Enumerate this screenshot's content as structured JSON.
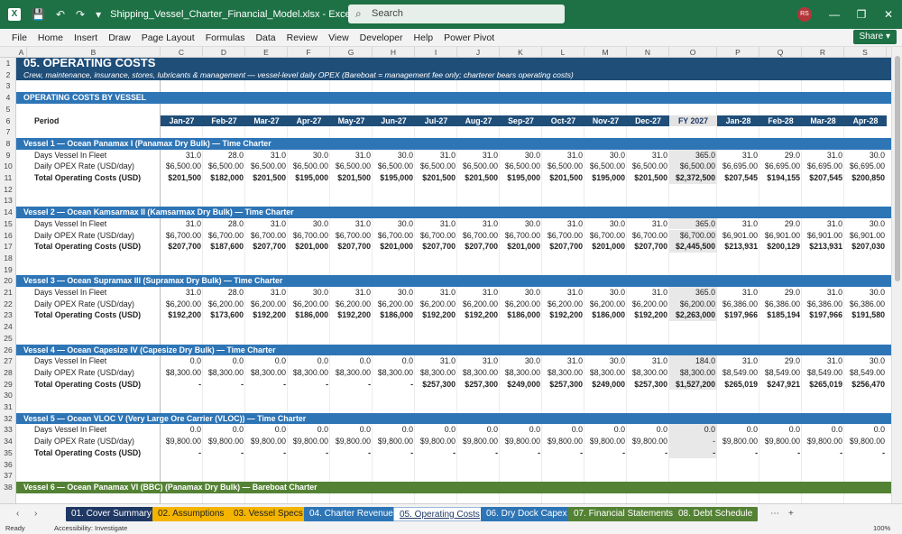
{
  "window": {
    "title": "Shipping_Vessel_Charter_Financial_Model.xlsx - Excel",
    "search_placeholder": "Search",
    "avatar": "RS",
    "app_icon": "X"
  },
  "menu": [
    "File",
    "Home",
    "Insert",
    "Draw",
    "Page Layout",
    "Formulas",
    "Data",
    "Review",
    "View",
    "Developer",
    "Help",
    "Power Pivot"
  ],
  "share_label": "Share",
  "columns": [
    "A",
    "B",
    "C",
    "D",
    "E",
    "F",
    "G",
    "H",
    "I",
    "J",
    "K",
    "L",
    "M",
    "N",
    "O",
    "P",
    "Q",
    "R",
    "S"
  ],
  "row_numbers": [
    "1",
    "2",
    "3",
    "4",
    "5",
    "6",
    "7",
    "8",
    "9",
    "10",
    "11",
    "12",
    "13",
    "14",
    "15",
    "16",
    "17",
    "18",
    "19",
    "20",
    "21",
    "22",
    "23",
    "24",
    "25",
    "26",
    "27",
    "28",
    "29",
    "30",
    "31",
    "32",
    "33",
    "34",
    "35",
    "36",
    "37",
    "38"
  ],
  "sheet": {
    "title": "05.  OPERATING COSTS",
    "subtitle": "Crew, maintenance, insurance, stores, lubricants & management — vessel-level daily OPEX (Bareboat = management fee only; charterer bears operating costs)",
    "section": "OPERATING COSTS BY VESSEL",
    "period_label": "Period",
    "periods": [
      "Jan-27",
      "Feb-27",
      "Mar-27",
      "Apr-27",
      "May-27",
      "Jun-27",
      "Jul-27",
      "Aug-27",
      "Sep-27",
      "Oct-27",
      "Nov-27",
      "Dec-27",
      "FY 2027",
      "Jan-28",
      "Feb-28",
      "Mar-28",
      "Apr-28"
    ],
    "vessels": [
      {
        "title": "Vessel 1  —  Ocean Panamax I  (Panamax Dry Bulk)  —  Time Charter",
        "band_color": "#2e75b6",
        "rows": [
          {
            "label": "Days Vessel In Fleet",
            "bold": false,
            "values": [
              "31.0",
              "28.0",
              "31.0",
              "30.0",
              "31.0",
              "30.0",
              "31.0",
              "31.0",
              "30.0",
              "31.0",
              "30.0",
              "31.0",
              "365.0",
              "31.0",
              "29.0",
              "31.0",
              "30.0"
            ]
          },
          {
            "label": "Daily OPEX Rate (USD/day)",
            "bold": false,
            "values": [
              "$6,500.00",
              "$6,500.00",
              "$6,500.00",
              "$6,500.00",
              "$6,500.00",
              "$6,500.00",
              "$6,500.00",
              "$6,500.00",
              "$6,500.00",
              "$6,500.00",
              "$6,500.00",
              "$6,500.00",
              "$6,500.00",
              "$6,695.00",
              "$6,695.00",
              "$6,695.00",
              "$6,695.00"
            ]
          },
          {
            "label": "Total Operating Costs (USD)",
            "bold": true,
            "values": [
              "$201,500",
              "$182,000",
              "$201,500",
              "$195,000",
              "$201,500",
              "$195,000",
              "$201,500",
              "$201,500",
              "$195,000",
              "$201,500",
              "$195,000",
              "$201,500",
              "$2,372,500",
              "$207,545",
              "$194,155",
              "$207,545",
              "$200,850"
            ]
          }
        ]
      },
      {
        "title": "Vessel 2  —  Ocean Kamsarmax II  (Kamsarmax Dry Bulk)  —  Time Charter",
        "band_color": "#2e75b6",
        "rows": [
          {
            "label": "Days Vessel In Fleet",
            "bold": false,
            "values": [
              "31.0",
              "28.0",
              "31.0",
              "30.0",
              "31.0",
              "30.0",
              "31.0",
              "31.0",
              "30.0",
              "31.0",
              "30.0",
              "31.0",
              "365.0",
              "31.0",
              "29.0",
              "31.0",
              "30.0"
            ]
          },
          {
            "label": "Daily OPEX Rate (USD/day)",
            "bold": false,
            "values": [
              "$6,700.00",
              "$6,700.00",
              "$6,700.00",
              "$6,700.00",
              "$6,700.00",
              "$6,700.00",
              "$6,700.00",
              "$6,700.00",
              "$6,700.00",
              "$6,700.00",
              "$6,700.00",
              "$6,700.00",
              "$6,700.00",
              "$6,901.00",
              "$6,901.00",
              "$6,901.00",
              "$6,901.00"
            ]
          },
          {
            "label": "Total Operating Costs (USD)",
            "bold": true,
            "values": [
              "$207,700",
              "$187,600",
              "$207,700",
              "$201,000",
              "$207,700",
              "$201,000",
              "$207,700",
              "$207,700",
              "$201,000",
              "$207,700",
              "$201,000",
              "$207,700",
              "$2,445,500",
              "$213,931",
              "$200,129",
              "$213,931",
              "$207,030"
            ]
          }
        ]
      },
      {
        "title": "Vessel 3  —  Ocean Supramax III  (Supramax Dry Bulk)  —  Time Charter",
        "band_color": "#2e75b6",
        "rows": [
          {
            "label": "Days Vessel In Fleet",
            "bold": false,
            "values": [
              "31.0",
              "28.0",
              "31.0",
              "30.0",
              "31.0",
              "30.0",
              "31.0",
              "31.0",
              "30.0",
              "31.0",
              "30.0",
              "31.0",
              "365.0",
              "31.0",
              "29.0",
              "31.0",
              "30.0"
            ]
          },
          {
            "label": "Daily OPEX Rate (USD/day)",
            "bold": false,
            "values": [
              "$6,200.00",
              "$6,200.00",
              "$6,200.00",
              "$6,200.00",
              "$6,200.00",
              "$6,200.00",
              "$6,200.00",
              "$6,200.00",
              "$6,200.00",
              "$6,200.00",
              "$6,200.00",
              "$6,200.00",
              "$6,200.00",
              "$6,386.00",
              "$6,386.00",
              "$6,386.00",
              "$6,386.00"
            ]
          },
          {
            "label": "Total Operating Costs (USD)",
            "bold": true,
            "values": [
              "$192,200",
              "$173,600",
              "$192,200",
              "$186,000",
              "$192,200",
              "$186,000",
              "$192,200",
              "$192,200",
              "$186,000",
              "$192,200",
              "$186,000",
              "$192,200",
              "$2,263,000",
              "$197,966",
              "$185,194",
              "$197,966",
              "$191,580"
            ]
          }
        ]
      },
      {
        "title": "Vessel 4  —  Ocean Capesize IV  (Capesize Dry Bulk)  —  Time Charter",
        "band_color": "#2e75b6",
        "rows": [
          {
            "label": "Days Vessel In Fleet",
            "bold": false,
            "values": [
              "0.0",
              "0.0",
              "0.0",
              "0.0",
              "0.0",
              "0.0",
              "31.0",
              "31.0",
              "30.0",
              "31.0",
              "30.0",
              "31.0",
              "184.0",
              "31.0",
              "29.0",
              "31.0",
              "30.0"
            ]
          },
          {
            "label": "Daily OPEX Rate (USD/day)",
            "bold": false,
            "values": [
              "$8,300.00",
              "$8,300.00",
              "$8,300.00",
              "$8,300.00",
              "$8,300.00",
              "$8,300.00",
              "$8,300.00",
              "$8,300.00",
              "$8,300.00",
              "$8,300.00",
              "$8,300.00",
              "$8,300.00",
              "$8,300.00",
              "$8,549.00",
              "$8,549.00",
              "$8,549.00",
              "$8,549.00"
            ]
          },
          {
            "label": "Total Operating Costs (USD)",
            "bold": true,
            "values": [
              "-",
              "-",
              "-",
              "-",
              "-",
              "-",
              "$257,300",
              "$257,300",
              "$249,000",
              "$257,300",
              "$249,000",
              "$257,300",
              "$1,527,200",
              "$265,019",
              "$247,921",
              "$265,019",
              "$256,470"
            ]
          }
        ]
      },
      {
        "title": "Vessel 5  —  Ocean VLOC V  (Very Large Ore Carrier (VLOC))  —  Time Charter",
        "band_color": "#2e75b6",
        "rows": [
          {
            "label": "Days Vessel In Fleet",
            "bold": false,
            "values": [
              "0.0",
              "0.0",
              "0.0",
              "0.0",
              "0.0",
              "0.0",
              "0.0",
              "0.0",
              "0.0",
              "0.0",
              "0.0",
              "0.0",
              "0.0",
              "0.0",
              "0.0",
              "0.0",
              "0.0"
            ]
          },
          {
            "label": "Daily OPEX Rate (USD/day)",
            "bold": false,
            "values": [
              "$9,800.00",
              "$9,800.00",
              "$9,800.00",
              "$9,800.00",
              "$9,800.00",
              "$9,800.00",
              "$9,800.00",
              "$9,800.00",
              "$9,800.00",
              "$9,800.00",
              "$9,800.00",
              "$9,800.00",
              "-",
              "$9,800.00",
              "$9,800.00",
              "$9,800.00",
              "$9,800.00"
            ]
          },
          {
            "label": "Total Operating Costs (USD)",
            "bold": true,
            "values": [
              "-",
              "-",
              "-",
              "-",
              "-",
              "-",
              "-",
              "-",
              "-",
              "-",
              "-",
              "-",
              "-",
              "-",
              "-",
              "-",
              "-"
            ]
          }
        ]
      },
      {
        "title": "Vessel 6  —  Ocean Panamax VI (BBC)  (Panamax Dry Bulk)  —  Bareboat Charter",
        "band_color": "#548235",
        "rows": []
      }
    ]
  },
  "tabs": [
    {
      "label": "01. Cover Summary",
      "bg": "#1f3864",
      "fg": "#ffffff"
    },
    {
      "label": "02. Assumptions",
      "bg": "#f4b400",
      "fg": "#222222"
    },
    {
      "label": "03. Vessel Specs",
      "bg": "#f4b400",
      "fg": "#222222"
    },
    {
      "label": "04. Charter Revenue",
      "bg": "#2e75b6",
      "fg": "#ffffff"
    },
    {
      "label": "05. Operating Costs",
      "bg": "#ffffff",
      "fg": "#1f3864",
      "active": true
    },
    {
      "label": "06. Dry Dock Capex",
      "bg": "#2e75b6",
      "fg": "#ffffff"
    },
    {
      "label": "07. Financial Statements",
      "bg": "#548235",
      "fg": "#ffffff"
    },
    {
      "label": "08. Debt Schedule",
      "bg": "#548235",
      "fg": "#ffffff"
    }
  ],
  "status": {
    "ready": "Ready",
    "accessibility": "Accessibility: Investigate",
    "zoom": "100%"
  }
}
